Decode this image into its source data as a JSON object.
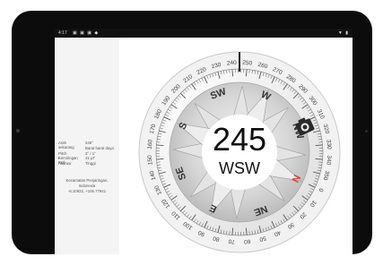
{
  "status_bar": {
    "time": "4:17",
    "icons": "▣ ▣ ▣ ◆",
    "battery": "▼ ▮"
  },
  "info": [
    {
      "label": "Arah sekarang",
      "value": "245°"
    },
    {
      "label": "",
      "value": "Barat barat daya"
    },
    {
      "label": "Pitch / Roll",
      "value": "3° / 1°"
    },
    {
      "label": "Kemiringan",
      "value": "41 µT"
    },
    {
      "label": "Akurasi",
      "value": "Tinggi"
    }
  ],
  "location": {
    "line1": "Kecamatan Penjaringan,",
    "line2": "Indonesia",
    "coords": "-6.10922, +106.77941"
  },
  "compass": {
    "heading_degrees": 245,
    "degrees_label": "245",
    "direction_label": "WSW",
    "degree_labels": [
      "0",
      "10",
      "20",
      "30",
      "40",
      "50",
      "60",
      "70",
      "80",
      "90",
      "100",
      "110",
      "120",
      "130",
      "140",
      "150",
      "160",
      "170",
      "180",
      "190",
      "200",
      "210",
      "220",
      "230",
      "240",
      "250",
      "260",
      "270",
      "280",
      "290",
      "300",
      "310",
      "320",
      "330",
      "340",
      "350"
    ],
    "cardinals": [
      "N",
      "NE",
      "E",
      "SE",
      "S",
      "SW",
      "W",
      "NW"
    ],
    "north_color": "#e53935",
    "ring_color": "#f2f2f2"
  }
}
